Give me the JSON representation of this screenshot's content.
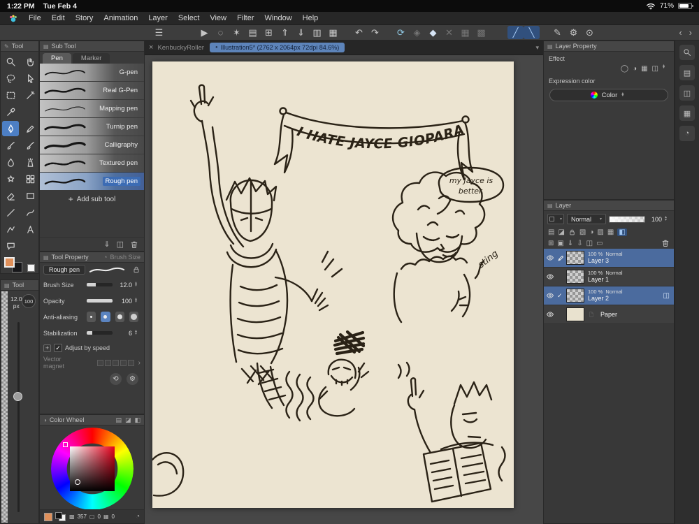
{
  "statusbar": {
    "time": "1:22 PM",
    "date": "Tue Feb 4",
    "battery_percent": "71%"
  },
  "menubar": {
    "items": [
      "File",
      "Edit",
      "Story",
      "Animation",
      "Layer",
      "Select",
      "View",
      "Filter",
      "Window",
      "Help"
    ]
  },
  "icons": {
    "menu": "☰",
    "object_select": "▶",
    "lasso_sel": "◌",
    "wand": "✶",
    "new_page": "▤",
    "open": "⊞",
    "export_up": "⇑",
    "import_down": "⇓",
    "copy": "▥",
    "paste": "▦",
    "undo": "↶",
    "redo": "↷",
    "reset_view": "⟳",
    "material": "◈",
    "snap_diamond": "◆",
    "clear": "✕",
    "grid": "▦",
    "tone": "▩",
    "snap_ruler": "╱",
    "snap_special": "╲",
    "ruler_pen": "✎",
    "settings": "⚙",
    "gesture": "⊙",
    "chev_left": "‹",
    "chev_right": "›",
    "chev_down": "▾",
    "chev_up": "▴",
    "plus": "+",
    "check": "✓",
    "close": "×",
    "dot": "●",
    "history": "⟲",
    "clock": "◔",
    "duplicate": "◫",
    "rows": "▤",
    "halfsq": "◪",
    "fillsq": "◧",
    "circle_o": "◯",
    "circle_half": "◑",
    "shade": "▧",
    "hatch": "▨",
    "sq_o": "▢",
    "new_layer": "⊞",
    "new_folder": "▣",
    "transfer": "⇓",
    "merge": "⇩",
    "flat": "▭",
    "arrow_r": "›"
  },
  "tool_panel": {
    "title": "Tool",
    "tools": [
      "zoom",
      "hand",
      "lasso",
      "operation",
      "marquee",
      "auto-select",
      "eyedropper",
      "pen",
      "pencil",
      "brush",
      "watercolor",
      "blend",
      "airbrush",
      "decoration",
      "pattern",
      "eraser",
      "eraser-soft",
      "line",
      "curve",
      "polyline",
      "text",
      "balloon"
    ],
    "selected_tool": "pen"
  },
  "quick_panel": {
    "title": "Tool",
    "size_value": "12.0",
    "size_unit": "px",
    "opacity_value": "100"
  },
  "subtool": {
    "title": "Sub Tool",
    "tabs": [
      "Pen",
      "Marker"
    ],
    "active_tab": "Pen",
    "pens": [
      "G-pen",
      "Real G-Pen",
      "Mapping pen",
      "Turnip pen",
      "Calligraphy",
      "Textured pen",
      "Rough pen"
    ],
    "selected_pen": "Rough pen",
    "add_label": "Add sub tool"
  },
  "tool_property": {
    "title": "Tool Property",
    "alt_tab": "Brush Size",
    "tool_name": "Rough pen",
    "brush_size": {
      "label": "Brush Size",
      "value": "12.0"
    },
    "opacity": {
      "label": "Opacity",
      "value": "100"
    },
    "anti_aliasing": {
      "label": "Anti-aliasing",
      "selected_index": 1
    },
    "stabilization": {
      "label": "Stabilization",
      "value": "6"
    },
    "adjust_by_speed": {
      "label": "Adjust by speed",
      "checked": true
    },
    "vector_magnet": {
      "label": "Vector magnet"
    }
  },
  "color_wheel": {
    "title": "Color Wheel",
    "hue_value": "357",
    "count_a": "0",
    "count_b": "0"
  },
  "canvas": {
    "background_tab": "KenbuckyRoller",
    "active_tab": "Illustration5* (2762 x 2064px 72dpi 84.6%)",
    "drawing": {
      "banner": "I HATE JAYCE GIOPARA",
      "bubble_line1": "my Jayce is",
      "bubble_line2": "better.",
      "annotation": "sting"
    }
  },
  "layer_property": {
    "title": "Layer Property",
    "effect_label": "Effect",
    "expression_label": "Expression color",
    "color_option": "Color"
  },
  "layer_panel": {
    "title": "Layer",
    "blend_mode": "Normal",
    "opacity_value": "100",
    "layers": [
      {
        "info": "100 %  Normal",
        "name": "Layer 3",
        "selected": true
      },
      {
        "info": "100 %  Normal",
        "name": "Layer 1",
        "selected": false
      },
      {
        "info": "100 %  Normal",
        "name": "Layer 2",
        "selected": true
      },
      {
        "name": "Paper",
        "selected": false
      }
    ]
  },
  "ui_colors": {
    "accent": "#5b84c0",
    "selection_blue": "#4b6b9e",
    "main_color": "#e0905a",
    "canvas_paper": "#ece4d1",
    "active_tab_blue": "#5d84ba"
  }
}
